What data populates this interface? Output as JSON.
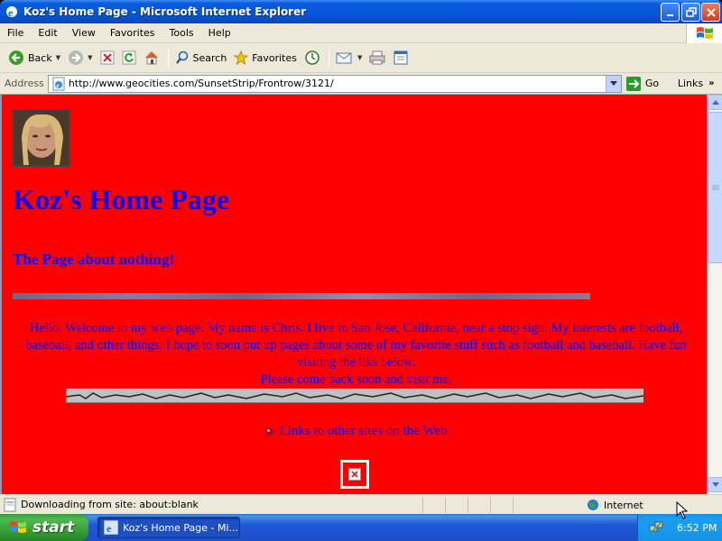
{
  "window": {
    "title": "Koz's Home Page - Microsoft Internet Explorer"
  },
  "menu": [
    "File",
    "Edit",
    "View",
    "Favorites",
    "Tools",
    "Help"
  ],
  "toolbar": {
    "back_label": "Back",
    "search_label": "Search",
    "favorites_label": "Favorites"
  },
  "address": {
    "label": "Address",
    "url": "http://www.geocities.com/SunsetStrip/Frontrow/3121/",
    "go_label": "Go",
    "links_label": "Links"
  },
  "page": {
    "title": "Koz's Home Page",
    "subtitle": "The Page about nothing!",
    "intro": "Hello. Welcome to my web page. My name is Chris. I live in San Jose, California, near a stop sign. My interests are football, baseball, and other things. I hope to soon put up pages about some of my favorite stuff such as football and baseball. Have fun visiting the liks below.",
    "come_back": "Please come back soon and visit me.",
    "links_text": "Links to other sites on the Web",
    "colors": {
      "background": "#ff0000",
      "text": "#0000ff"
    }
  },
  "status": {
    "text": "Downloading from site: about:blank",
    "zone": "Internet"
  },
  "taskbar": {
    "start_label": "start",
    "task_label": "Koz's Home Page - Mi...",
    "clock": "6:52 PM"
  },
  "icons": {
    "app": "ie-icon",
    "back": "back-arrow-icon",
    "forward": "forward-arrow-icon",
    "stop": "stop-icon",
    "refresh": "refresh-icon",
    "home": "home-icon",
    "search": "search-icon",
    "favorites": "favorites-star-icon",
    "history": "history-icon",
    "mail": "mail-icon",
    "print": "print-icon",
    "edit": "edit-icon"
  }
}
